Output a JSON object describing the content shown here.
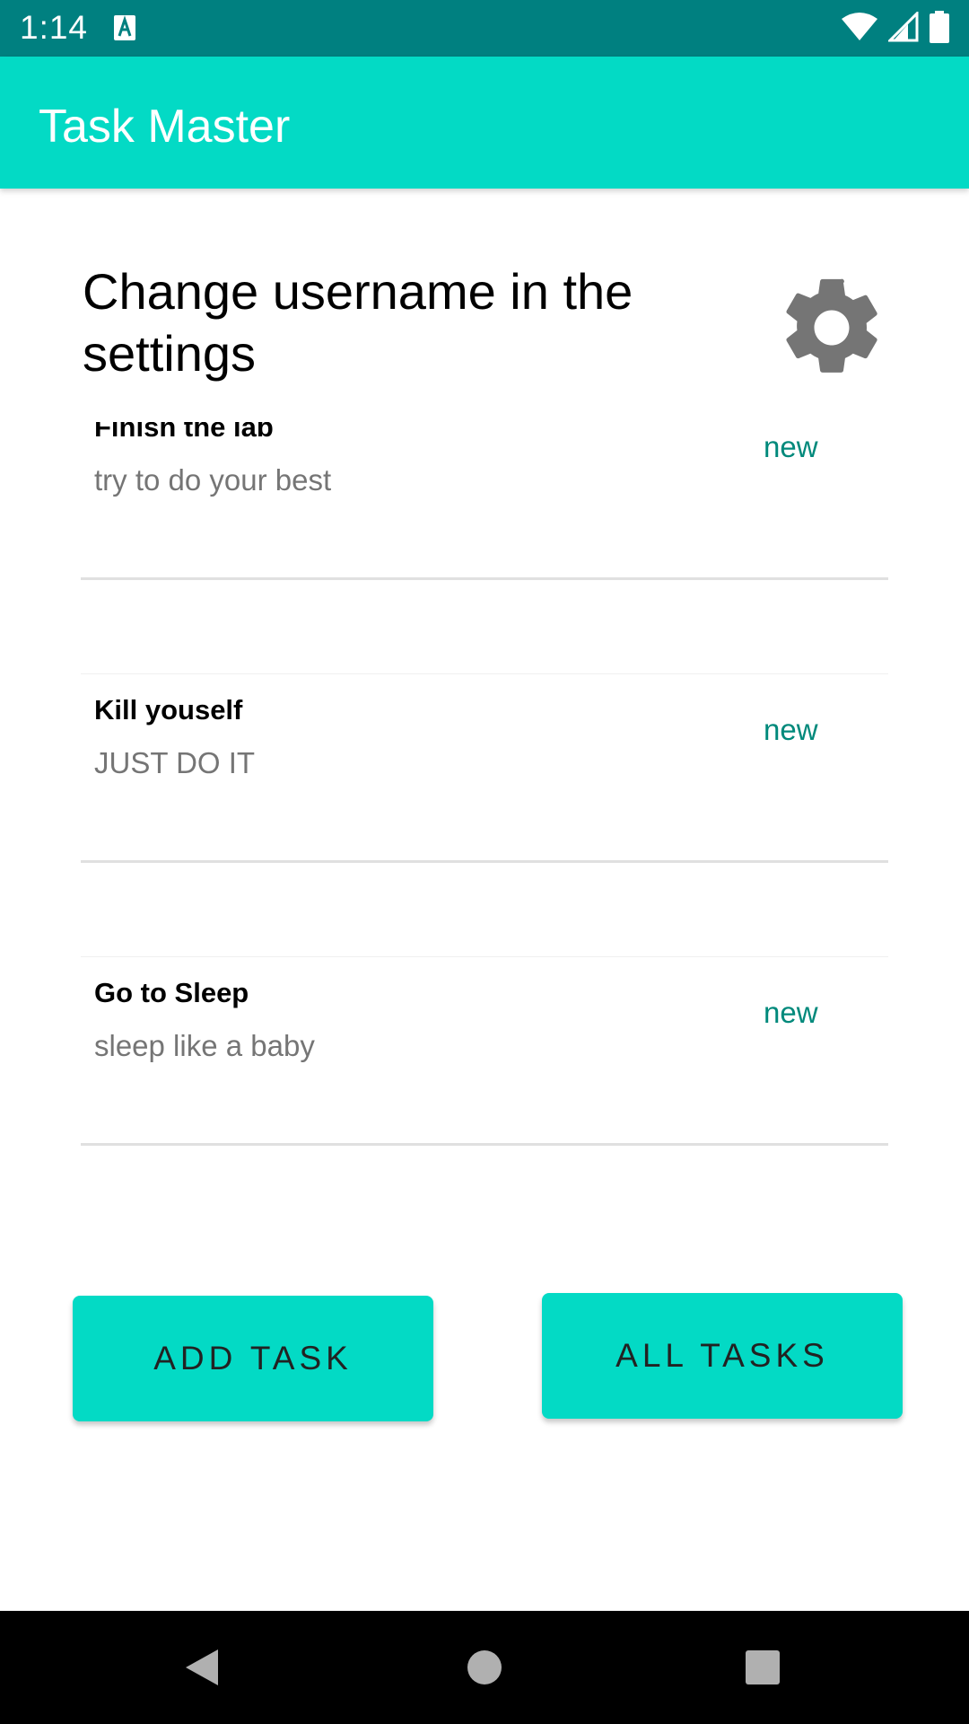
{
  "status_bar": {
    "time": "1:14",
    "icons": [
      "a-notification-icon",
      "wifi-icon",
      "cell-signal-icon",
      "battery-icon"
    ]
  },
  "app_bar": {
    "title": "Task Master"
  },
  "header": {
    "prompt": "Change username in the settings",
    "settings_icon": "gear-icon"
  },
  "tasks": [
    {
      "title": "Finish the lab",
      "body": "try to do your best",
      "status": "new"
    },
    {
      "title": "Kill youself",
      "body": "JUST DO IT",
      "status": "new"
    },
    {
      "title": "Go to Sleep",
      "body": "sleep like a baby",
      "status": "new"
    }
  ],
  "buttons": {
    "add_task": "ADD TASK",
    "all_tasks": "ALL TASKS"
  },
  "nav_bar": {
    "icons": [
      "back-icon",
      "home-icon",
      "recents-icon"
    ]
  },
  "colors": {
    "status_bar": "#008080",
    "accent": "#03dac5",
    "status_text": "#00897b"
  }
}
